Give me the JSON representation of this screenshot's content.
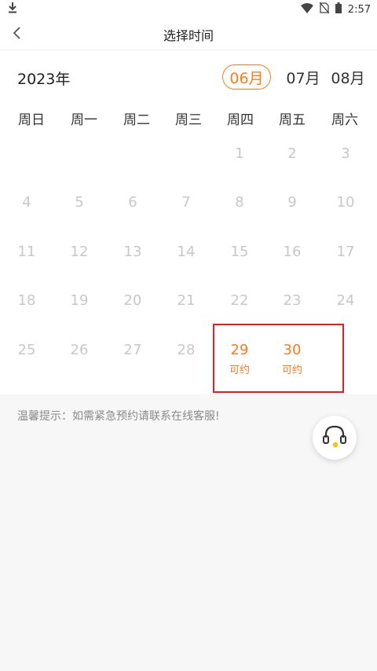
{
  "status_bar": {
    "time": "2:57",
    "icons": [
      "download-icon",
      "wifi-icon",
      "no-sim-icon",
      "battery-icon"
    ]
  },
  "nav": {
    "title": "选择时间",
    "back_icon": "chevron-left-icon"
  },
  "calendar": {
    "year": "2023年",
    "months": [
      {
        "label": "06月",
        "active": true
      },
      {
        "label": "07月",
        "active": false
      },
      {
        "label": "08月",
        "active": false
      }
    ],
    "weekdays": [
      "周日",
      "周一",
      "周二",
      "周三",
      "周四",
      "周五",
      "周六"
    ],
    "days": [
      {
        "num": "1",
        "sub": "",
        "available": false
      },
      {
        "num": "2",
        "sub": "",
        "available": false
      },
      {
        "num": "3",
        "sub": "",
        "available": false
      },
      {
        "num": "4",
        "sub": "",
        "available": false
      },
      {
        "num": "5",
        "sub": "",
        "available": false
      },
      {
        "num": "6",
        "sub": "",
        "available": false
      },
      {
        "num": "7",
        "sub": "",
        "available": false
      },
      {
        "num": "8",
        "sub": "",
        "available": false
      },
      {
        "num": "9",
        "sub": "",
        "available": false
      },
      {
        "num": "10",
        "sub": "",
        "available": false
      },
      {
        "num": "11",
        "sub": "",
        "available": false
      },
      {
        "num": "12",
        "sub": "",
        "available": false
      },
      {
        "num": "13",
        "sub": "",
        "available": false
      },
      {
        "num": "14",
        "sub": "",
        "available": false
      },
      {
        "num": "15",
        "sub": "",
        "available": false
      },
      {
        "num": "16",
        "sub": "",
        "available": false
      },
      {
        "num": "17",
        "sub": "",
        "available": false
      },
      {
        "num": "18",
        "sub": "",
        "available": false
      },
      {
        "num": "19",
        "sub": "",
        "available": false
      },
      {
        "num": "20",
        "sub": "",
        "available": false
      },
      {
        "num": "21",
        "sub": "",
        "available": false
      },
      {
        "num": "22",
        "sub": "",
        "available": false
      },
      {
        "num": "23",
        "sub": "",
        "available": false
      },
      {
        "num": "24",
        "sub": "",
        "available": false
      },
      {
        "num": "25",
        "sub": "",
        "available": false
      },
      {
        "num": "26",
        "sub": "",
        "available": false
      },
      {
        "num": "27",
        "sub": "",
        "available": false
      },
      {
        "num": "28",
        "sub": "",
        "available": false
      },
      {
        "num": "29",
        "sub": "可约",
        "available": true
      },
      {
        "num": "30",
        "sub": "可约",
        "available": true
      }
    ]
  },
  "tip": "温馨提示：如需紧急预约请联系在线客服!",
  "service_button_icon": "headset-icon",
  "colors": {
    "accent": "#ff7a1a",
    "disabled_day": "#c8c8c8",
    "highlight_box": "#e02020",
    "page_bg": "#f7f7f7"
  }
}
